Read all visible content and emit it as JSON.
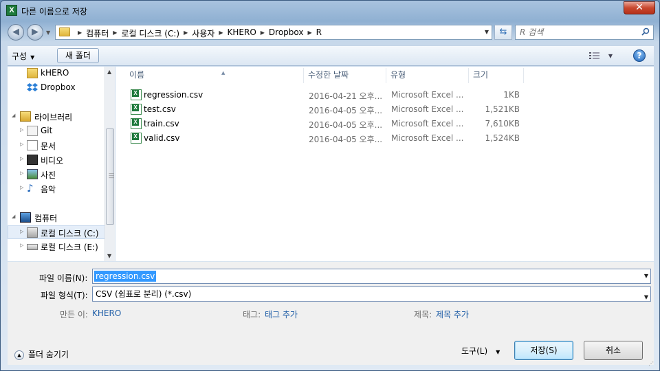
{
  "window": {
    "title": "다른 이름으로 저장",
    "close_label": "✕"
  },
  "address": {
    "crumbs": [
      "컴퓨터",
      "로컬 디스크 (C:)",
      "사용자",
      "KHERO",
      "Dropbox",
      "R"
    ],
    "search_placeholder": "R 검색"
  },
  "toolbar": {
    "organize_label": "구성",
    "new_folder_label": "새 폴더"
  },
  "nav": {
    "items": [
      {
        "label": "kHERO",
        "icon": "user-folder-icon"
      },
      {
        "label": "Dropbox",
        "icon": "dropbox-icon"
      },
      {
        "label": "라이브러리",
        "icon": "library-icon"
      },
      {
        "label": "Git",
        "icon": "git-library-icon"
      },
      {
        "label": "문서",
        "icon": "documents-icon"
      },
      {
        "label": "비디오",
        "icon": "video-icon"
      },
      {
        "label": "사진",
        "icon": "pictures-icon"
      },
      {
        "label": "음악",
        "icon": "music-icon"
      },
      {
        "label": "컴퓨터",
        "icon": "computer-icon"
      },
      {
        "label": "로컬 디스크 (C:)",
        "icon": "drive-c-icon"
      },
      {
        "label": "로컬 디스크 (E:)",
        "icon": "drive-e-icon"
      }
    ]
  },
  "files": {
    "columns": [
      "이름",
      "수정한 날짜",
      "유형",
      "크기"
    ],
    "rows": [
      {
        "name": "regression.csv",
        "date": "2016-04-21 오후...",
        "type": "Microsoft Excel ...",
        "size": "1KB"
      },
      {
        "name": "test.csv",
        "date": "2016-04-05 오후...",
        "type": "Microsoft Excel ...",
        "size": "1,521KB"
      },
      {
        "name": "train.csv",
        "date": "2016-04-05 오후...",
        "type": "Microsoft Excel ...",
        "size": "7,610KB"
      },
      {
        "name": "valid.csv",
        "date": "2016-04-05 오후...",
        "type": "Microsoft Excel ...",
        "size": "1,524KB"
      }
    ]
  },
  "form": {
    "filename_label": "파일 이름(N):",
    "filename_value": "regression.csv",
    "filetype_label": "파일 형식(T):",
    "filetype_value": "CSV (쉼표로 분리) (*.csv)",
    "author_label": "만든 이:",
    "author_value": "KHERO",
    "tags_label": "태그:",
    "tags_value": "태그 추가",
    "title_label": "제목:",
    "title_value": "제목 추가"
  },
  "footer": {
    "hide_folders_label": "폴더 숨기기",
    "tools_label": "도구(L)",
    "save_label": "저장(S)",
    "cancel_label": "취소"
  },
  "colors": {
    "selection": "#3399ff",
    "link": "#2260a8",
    "excel_green": "#1e7a3c"
  }
}
